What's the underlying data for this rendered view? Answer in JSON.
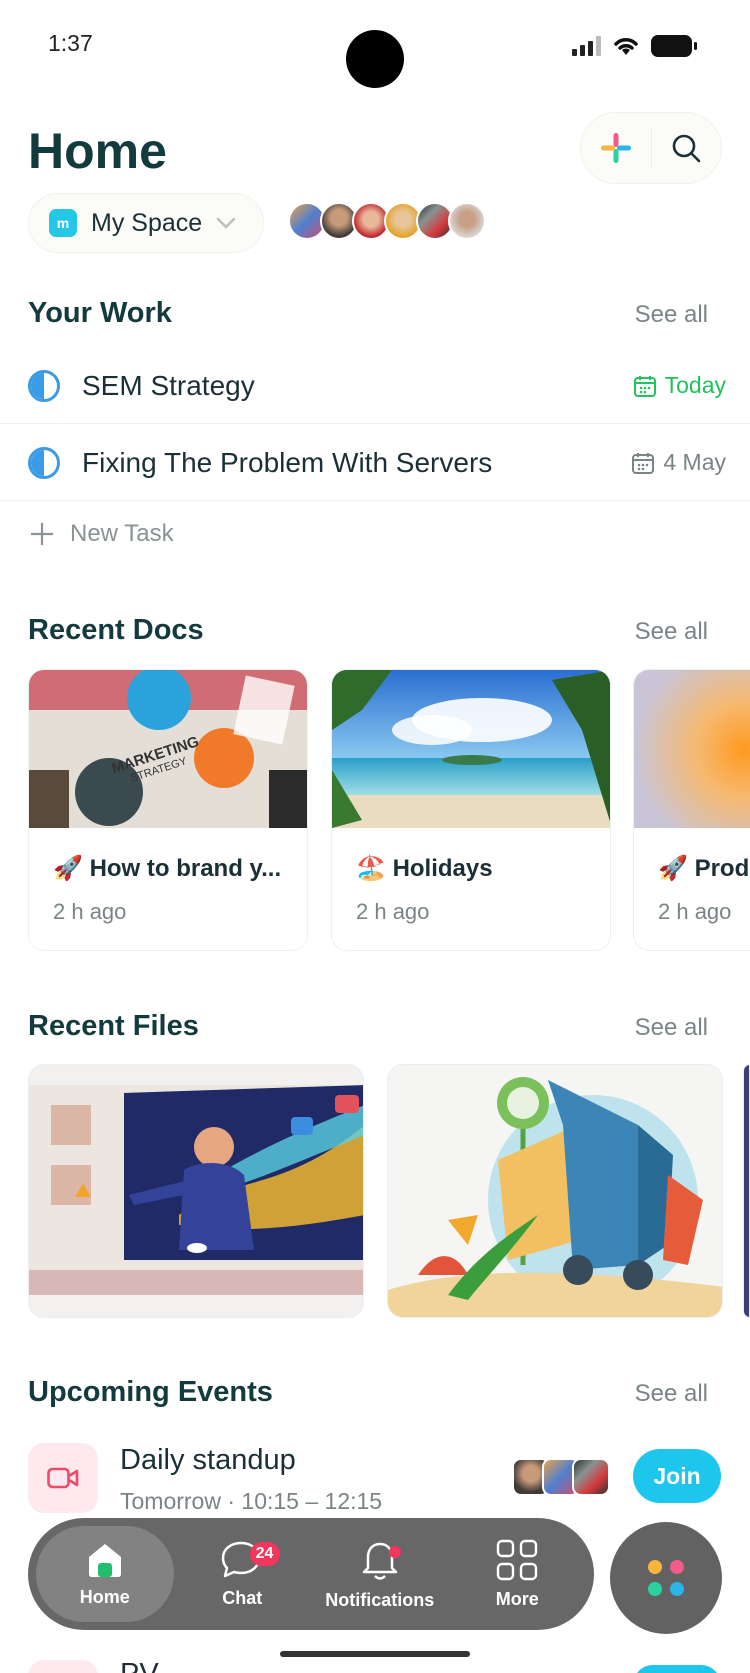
{
  "status_bar": {
    "time": "1:37"
  },
  "header": {
    "title": "Home"
  },
  "space": {
    "icon_letter": "m",
    "label": "My Space"
  },
  "your_work": {
    "title": "Your Work",
    "see_all": "See all",
    "tasks": [
      {
        "name": "SEM Strategy",
        "date": "Today",
        "date_color": "#22c35e"
      },
      {
        "name": "Fixing The Problem With Servers",
        "date": "4 May",
        "date_color": "#7a8487"
      }
    ],
    "new_task": "New Task"
  },
  "recent_docs": {
    "title": "Recent Docs",
    "see_all": "See all",
    "docs": [
      {
        "emoji": "🚀",
        "title": "How to brand y...",
        "time": "2 h ago"
      },
      {
        "emoji": "🏖️",
        "title": "Holidays",
        "time": "2 h ago"
      },
      {
        "emoji": "🚀",
        "title": "Prod",
        "time": "2 h ago"
      }
    ]
  },
  "recent_files": {
    "title": "Recent Files",
    "see_all": "See all"
  },
  "upcoming_events": {
    "title": "Upcoming Events",
    "see_all": "See all",
    "events": [
      {
        "title": "Daily standup",
        "time": "Tomorrow · 10:15 – 12:15",
        "action": "Join"
      },
      {
        "title": "PV",
        "time": "",
        "action": ""
      }
    ]
  },
  "tabbar": {
    "tabs": [
      {
        "label": "Home",
        "icon": "home-icon"
      },
      {
        "label": "Chat",
        "icon": "chat-icon",
        "badge": "24"
      },
      {
        "label": "Notifications",
        "icon": "bell-icon"
      },
      {
        "label": "More",
        "icon": "grid-icon"
      }
    ]
  },
  "colors": {
    "accent": "#1cc6ec",
    "heading": "#133a3c",
    "badge": "#f2365c",
    "today": "#22c35e"
  }
}
